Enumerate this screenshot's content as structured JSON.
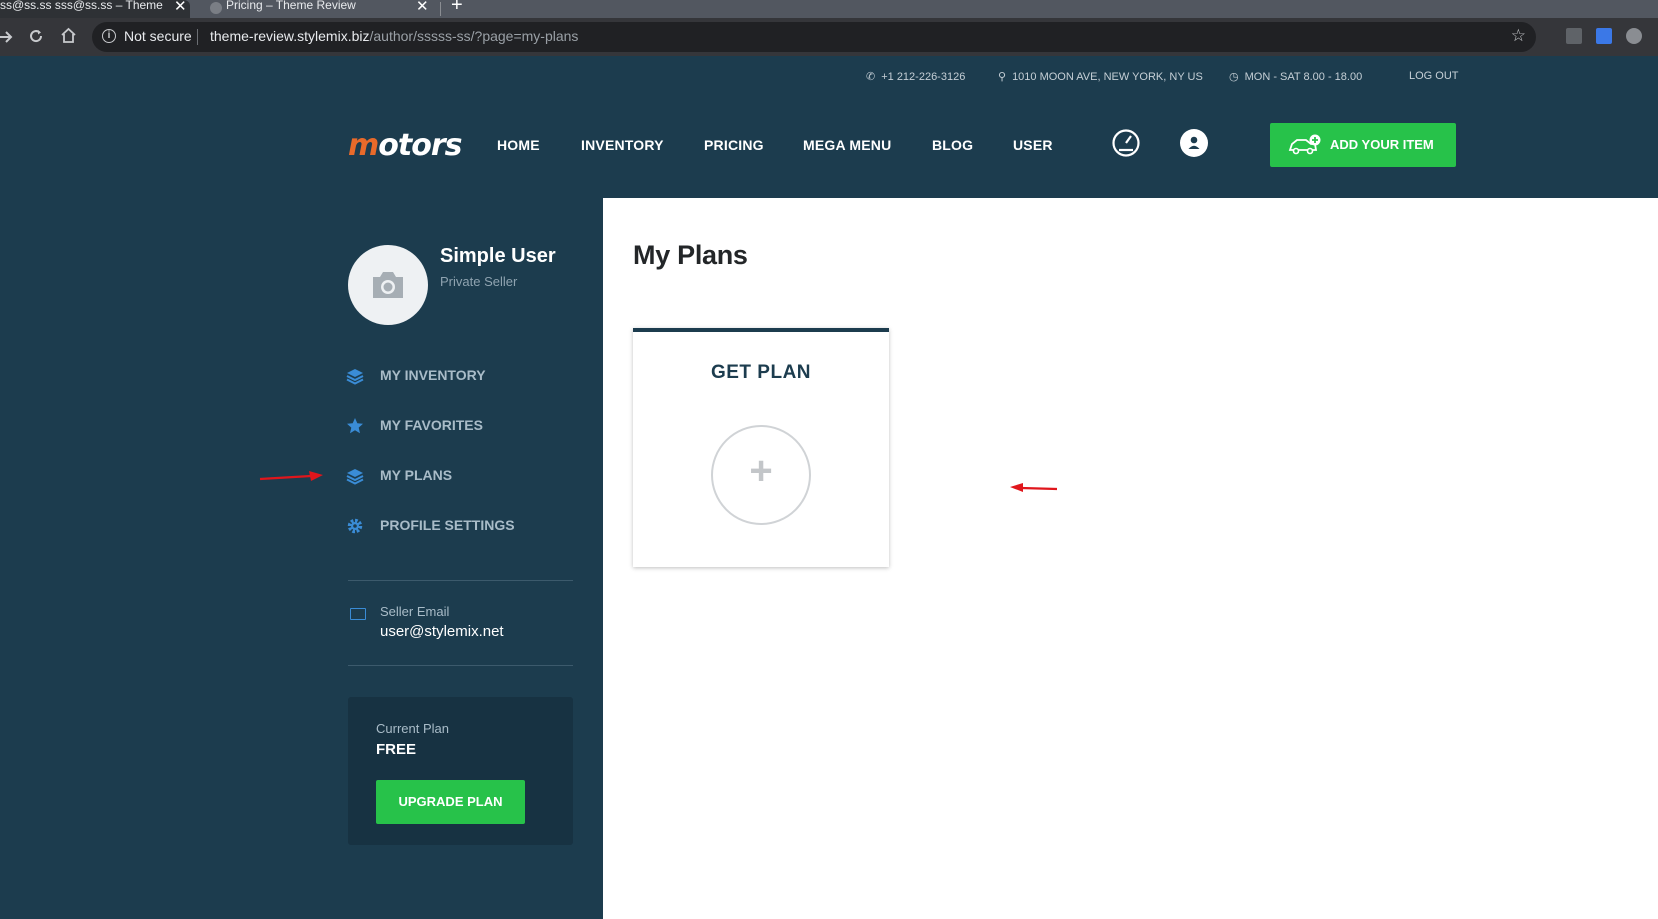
{
  "browser": {
    "tabs": [
      {
        "title": "ss@ss.ss sss@ss.ss – Theme Review",
        "close": "✕"
      },
      {
        "title": "Pricing – Theme Review",
        "close": "✕"
      }
    ],
    "new_tab": "+",
    "security": "Not secure",
    "url_host": "theme-review.stylemix.biz",
    "url_path": "/author/sssss-ss/?page=my-plans"
  },
  "topbar": {
    "phone": "+1 212-226-3126",
    "address": "1010 MOON AVE, NEW YORK, NY US",
    "hours": "MON - SAT 8.00 - 18.00",
    "logout": "LOG OUT"
  },
  "header": {
    "logo_accent": "m",
    "logo_rest": "otors",
    "nav": [
      "HOME",
      "INVENTORY",
      "PRICING",
      "MEGA MENU",
      "BLOG",
      "USER"
    ],
    "add_item": "ADD YOUR ITEM"
  },
  "sidebar": {
    "user_name": "Simple User",
    "user_role": "Private Seller",
    "items": [
      {
        "label": "MY INVENTORY",
        "icon": "layers-icon"
      },
      {
        "label": "MY FAVORITES",
        "icon": "star-icon"
      },
      {
        "label": "MY PLANS",
        "icon": "layers-icon"
      },
      {
        "label": "PROFILE SETTINGS",
        "icon": "gear-icon"
      }
    ],
    "email_label": "Seller Email",
    "email_value": "user@stylemix.net",
    "plan_label": "Current Plan",
    "plan_value": "FREE",
    "upgrade": "UPGRADE PLAN"
  },
  "main": {
    "title": "My Plans",
    "card_title": "GET PLAN",
    "card_plus": "+"
  },
  "colors": {
    "background": "#1c3c4e",
    "accent_green": "#27c24a",
    "logo_orange": "#e86a2a",
    "icon_blue": "#3a8cd6",
    "annotation_red": "#e0161c"
  }
}
